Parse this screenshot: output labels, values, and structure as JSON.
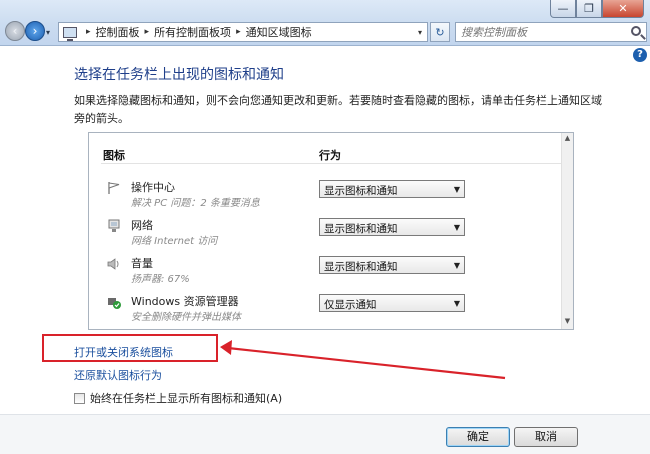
{
  "window": {
    "controls": {
      "minimize": "—",
      "maximize": "❐",
      "close": "✕"
    }
  },
  "nav": {
    "back": "‹",
    "forward": "›",
    "dropdown": "▾"
  },
  "address": {
    "crumbs": [
      "控制面板",
      "所有控制面板项",
      "通知区域图标"
    ],
    "separator": "▸",
    "dropdown": "▾",
    "refresh": "↻"
  },
  "search": {
    "placeholder": "搜索控制面板"
  },
  "help": "?",
  "page": {
    "title": "选择在任务栏上出现的图标和通知",
    "description": "如果选择隐藏图标和通知，则不会向您通知更改和更新。若要随时查看隐藏的图标，请单击任务栏上通知区域旁的箭头。"
  },
  "table": {
    "headers": {
      "icon": "图标",
      "behavior": "行为"
    },
    "rows": [
      {
        "name": "操作中心",
        "sub": "解决 PC 问题：2 条重要消息",
        "icon": "flag-icon",
        "value": "显示图标和通知"
      },
      {
        "name": "网络",
        "sub": "网络 Internet 访问",
        "icon": "network-icon",
        "value": "显示图标和通知"
      },
      {
        "name": "音量",
        "sub": "扬声器: 67%",
        "icon": "speaker-icon",
        "value": "显示图标和通知"
      },
      {
        "name": "Windows 资源管理器",
        "sub": "安全删除硬件并弹出媒体",
        "icon": "usb-eject-icon",
        "value": "仅显示通知"
      }
    ],
    "select_arrow": "▼",
    "scroll_up": "▲",
    "scroll_down": "▼"
  },
  "links": {
    "system_icons": "打开或关闭系统图标",
    "restore_defaults": "还原默认图标行为"
  },
  "checkbox": {
    "label": "始终在任务栏上显示所有图标和通知(A)",
    "checked": false
  },
  "buttons": {
    "ok": "确定",
    "cancel": "取消"
  },
  "annotation": {
    "color": "#d9222a"
  }
}
